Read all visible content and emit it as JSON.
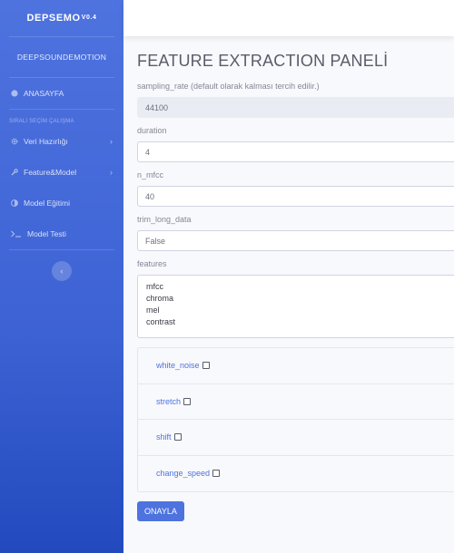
{
  "sidebar": {
    "brand_name": "DEPSEMO",
    "brand_version": "V0.4",
    "sub_brand": "DEEPSOUNDEMOTION",
    "home_label": "ANASAYFA",
    "section_heading": "SIRALI SEÇİM ÇALIŞMA",
    "items": [
      {
        "label": "Veri Hazırlığı",
        "icon": "gear-icon",
        "has_chevron": true
      },
      {
        "label": "Feature&Model",
        "icon": "wrench-icon",
        "has_chevron": true
      },
      {
        "label": "Model Eğitimi",
        "icon": "toggle-icon",
        "has_chevron": false
      },
      {
        "label": "Model Testi",
        "icon": "terminal-icon",
        "has_chevron": false
      }
    ],
    "chevron_glyph": "›",
    "toggle_glyph": "‹"
  },
  "main": {
    "title": "FEATURE EXTRACTION PANELİ",
    "fields": {
      "sampling_rate": {
        "label": "sampling_rate (default olarak kalması tercih edilir.)",
        "value": "44100"
      },
      "duration": {
        "label": "duration",
        "value": "4"
      },
      "n_mfcc": {
        "label": "n_mfcc",
        "value": "40"
      },
      "trim_long_data": {
        "label": "trim_long_data",
        "value": "False"
      }
    },
    "features": {
      "label": "features",
      "options": [
        "mfcc",
        "chroma",
        "mel",
        "contrast"
      ]
    },
    "checkboxes": [
      {
        "label": "white_noise",
        "checked": false
      },
      {
        "label": "stretch",
        "checked": false
      },
      {
        "label": "shift",
        "checked": false
      },
      {
        "label": "change_speed",
        "checked": false
      }
    ],
    "submit_label": "ONAYLA"
  },
  "colors": {
    "primary": "#4e73df",
    "sidebar_dark": "#224abe",
    "text_gray": "#858796"
  }
}
